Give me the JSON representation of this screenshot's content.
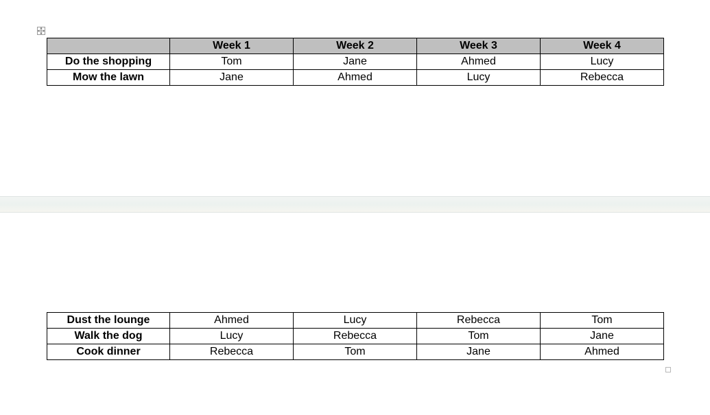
{
  "columns": [
    "",
    "Week 1",
    "Week 2",
    "Week 3",
    "Week 4"
  ],
  "rowsTop": [
    {
      "label": "Do the shopping",
      "cells": [
        "Tom",
        "Jane",
        "Ahmed",
        "Lucy"
      ]
    },
    {
      "label": "Mow the lawn",
      "cells": [
        "Jane",
        "Ahmed",
        "Lucy",
        "Rebecca"
      ]
    }
  ],
  "rowsBottom": [
    {
      "label": "Dust the lounge",
      "cells": [
        "Ahmed",
        "Lucy",
        "Rebecca",
        "Tom"
      ]
    },
    {
      "label": "Walk the dog",
      "cells": [
        "Lucy",
        "Rebecca",
        "Tom",
        "Jane"
      ]
    },
    {
      "label": "Cook dinner",
      "cells": [
        "Rebecca",
        "Tom",
        "Jane",
        "Ahmed"
      ]
    }
  ]
}
